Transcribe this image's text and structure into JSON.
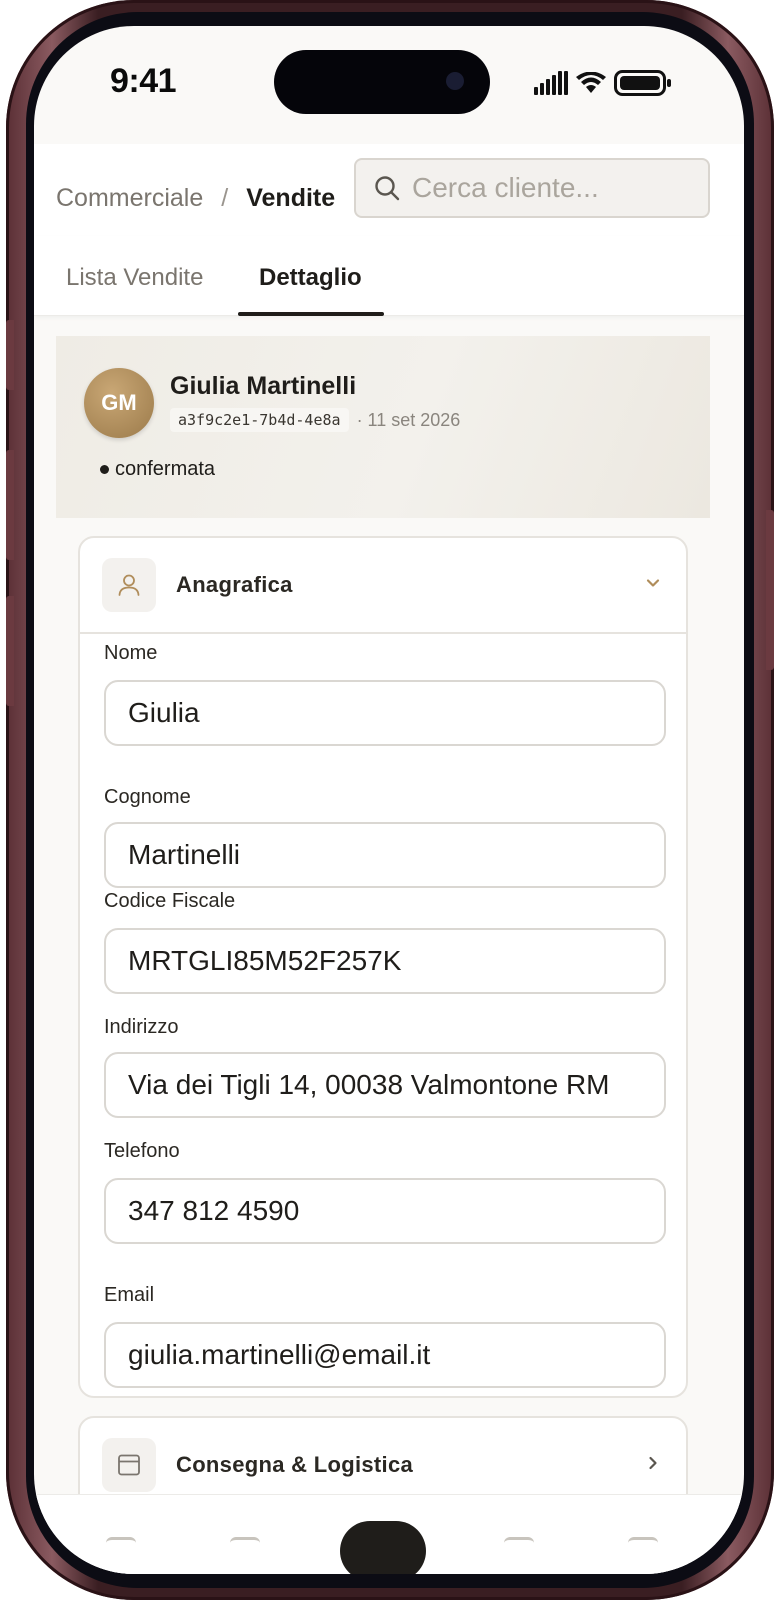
{
  "status_bar": {
    "time": "9:41"
  },
  "breadcrumb": {
    "parent": "Commerciale",
    "separator": "/",
    "current": "Vendite"
  },
  "search": {
    "placeholder": "Cerca cliente..."
  },
  "tabs": [
    {
      "label": "Lista Vendite",
      "active": false
    },
    {
      "label": "Dettaglio",
      "active": true
    }
  ],
  "customer": {
    "initials": "GM",
    "name": "Giulia Martinelli",
    "id": "a3f9c2e1-7b4d-4e8a",
    "date": "· 11 set 2026",
    "status": "confermata"
  },
  "sections": {
    "anagrafica": {
      "title": "Anagrafica",
      "icon": "user-icon",
      "expanded": true,
      "fields": [
        {
          "label": "Nome",
          "value": "Giulia"
        },
        {
          "label": "Cognome",
          "value": "Martinelli"
        },
        {
          "label": "Codice Fiscale",
          "value": "MRTGLI85M52F257K"
        },
        {
          "label": "Indirizzo",
          "value": "Via dei Tigli 14, 00038 Valmontone RM"
        },
        {
          "label": "Telefono",
          "value": "347 812 4590"
        },
        {
          "label": "Email",
          "value": "giulia.martinelli@email.it"
        }
      ]
    },
    "logistica": {
      "title": "Consegna & Logistica",
      "icon": "calendar-icon",
      "expanded": false
    }
  },
  "colors": {
    "accent": "#b08d5b",
    "text": "#1f1d1a",
    "muted": "#7a756e",
    "frame": "#5a2f35"
  }
}
